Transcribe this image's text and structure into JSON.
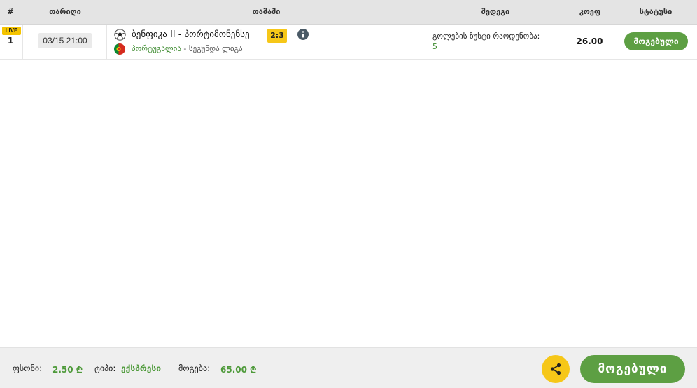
{
  "table": {
    "headers": {
      "num": "#",
      "date": "თარიღი",
      "match": "თამაში",
      "outcome": "შედეგი",
      "odds": "კოეფ",
      "status": "სტატუსი"
    },
    "rows": [
      {
        "live": "LIVE",
        "num": "1",
        "date": "03/15 21:00",
        "match": "ბენფიკა II - პორტიმონენსე",
        "score": "2:3",
        "country": "პორტუგალია",
        "league": " - სეგუნდა ლიგა",
        "outcome_label": "გოლების ზუსტი რაოდენობა:",
        "outcome_value": "5",
        "odds": "26.00",
        "status": "მოგებული",
        "icons": {
          "sport": "soccer-ball-icon",
          "flag": "portugal-flag-icon",
          "info": "info-icon"
        }
      }
    ]
  },
  "footer": {
    "stake_label": "ფსონი:",
    "stake_value": "2.50 ₾",
    "type_label": "ტიპი:",
    "type_value": "ექსპრესი",
    "win_label": "მოგება:",
    "win_value": "65.00 ₾",
    "status": "მოგებული",
    "share_icon": "share-icon"
  },
  "colors": {
    "accent_green": "#5d9f43",
    "accent_yellow": "#f6c718",
    "header_bg": "#e4e4e4",
    "footer_bg": "#efefef"
  }
}
